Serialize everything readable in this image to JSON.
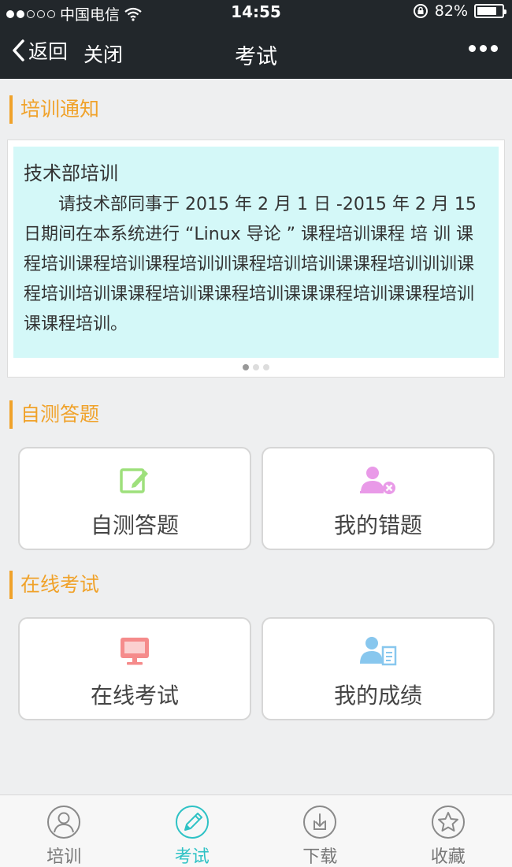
{
  "status_bar": {
    "carrier": "中国电信",
    "time": "14:55",
    "battery": "82%",
    "battery_level": 0.82
  },
  "nav": {
    "back_label": "返回",
    "close_label": "关闭",
    "title": "考试"
  },
  "notice_section": {
    "title": "培训通知",
    "card": {
      "heading": "技术部培训",
      "body": "请技术部同事于 2015 年 2 月 1 日 -2015 年 2 月 15 日期间在本系统进行 “Linux 导论 ” 课程培训课程 培 训 课 程培训课程培训课程培训训课程培训培训课课程培训训训课程培训培训课课程培训课课程培训课课课程培训课课程培训课课程培训。",
      "page_count": 3,
      "active_page": 1
    }
  },
  "self_test_section": {
    "title": "自测答题",
    "tiles": [
      {
        "label": "自测答题",
        "icon": "edit-icon",
        "color": "#9ee07c"
      },
      {
        "label": "我的错题",
        "icon": "user-error-icon",
        "color": "#e99ae8"
      }
    ]
  },
  "online_exam_section": {
    "title": "在线考试",
    "tiles": [
      {
        "label": "在线考试",
        "icon": "monitor-icon",
        "color": "#f58b8b"
      },
      {
        "label": "我的成绩",
        "icon": "user-document-icon",
        "color": "#88c7ee"
      }
    ]
  },
  "tab_bar": {
    "items": [
      {
        "label": "培训",
        "icon": "person-icon"
      },
      {
        "label": "考试",
        "icon": "pencil-icon",
        "active": true
      },
      {
        "label": "下载",
        "icon": "download-icon"
      },
      {
        "label": "收藏",
        "icon": "star-icon"
      }
    ],
    "active_color": "#2ec2c5",
    "inactive_color": "#8a8a8a"
  },
  "colors": {
    "accent": "#f0a22a",
    "header_bg": "#22272b",
    "notice_bg": "#d4f8f8",
    "page_bg": "#eeeff0"
  }
}
